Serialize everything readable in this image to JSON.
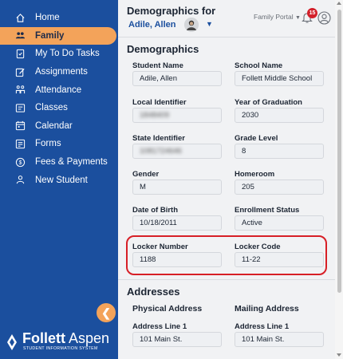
{
  "sidebar": {
    "items": [
      {
        "label": "Home",
        "icon": "home-icon"
      },
      {
        "label": "Family",
        "icon": "family-icon",
        "active": true
      },
      {
        "label": "My To Do Tasks",
        "icon": "tasks-icon"
      },
      {
        "label": "Assignments",
        "icon": "assignments-icon"
      },
      {
        "label": "Attendance",
        "icon": "attendance-icon"
      },
      {
        "label": "Classes",
        "icon": "classes-icon"
      },
      {
        "label": "Calendar",
        "icon": "calendar-icon"
      },
      {
        "label": "Forms",
        "icon": "forms-icon"
      },
      {
        "label": "Fees & Payments",
        "icon": "fees-icon"
      },
      {
        "label": "New Student",
        "icon": "new-student-icon"
      }
    ],
    "collapse_glyph": "❮",
    "logo_brand": "Follett",
    "logo_product": "Aspen",
    "logo_tagline": "STUDENT INFORMATION SYSTEM"
  },
  "header": {
    "title": "Demographics for",
    "student_name": "Adile, Allen",
    "portal": "Family Portal",
    "notification_count": "15"
  },
  "demographics": {
    "title": "Demographics",
    "fields": {
      "student_name": {
        "label": "Student Name",
        "value": "Adile, Allen"
      },
      "school_name": {
        "label": "School Name",
        "value": "Follett Middle School"
      },
      "local_identifier": {
        "label": "Local Identifier",
        "value": "1848409"
      },
      "year_of_graduation": {
        "label": "Year of Graduation",
        "value": "2030"
      },
      "state_identifier": {
        "label": "State Identifier",
        "value": "1081724646"
      },
      "grade_level": {
        "label": "Grade Level",
        "value": "8"
      },
      "gender": {
        "label": "Gender",
        "value": "M"
      },
      "homeroom": {
        "label": "Homeroom",
        "value": "205"
      },
      "date_of_birth": {
        "label": "Date of Birth",
        "value": "10/18/2011"
      },
      "enrollment_status": {
        "label": "Enrollment Status",
        "value": "Active"
      },
      "locker_number": {
        "label": "Locker Number",
        "value": "1188"
      },
      "locker_code": {
        "label": "Locker Code",
        "value": "11-22"
      }
    }
  },
  "addresses": {
    "title": "Addresses",
    "physical": {
      "title": "Physical Address",
      "line1_label": "Address Line 1",
      "line1_value": "101 Main St."
    },
    "mailing": {
      "title": "Mailing Address",
      "line1_label": "Address Line 1",
      "line1_value": "101 Main St."
    }
  },
  "colors": {
    "sidebar": "#1b4f9e",
    "accent": "#f3a35a",
    "highlight": "#d71f26",
    "badge": "#d3202a"
  }
}
